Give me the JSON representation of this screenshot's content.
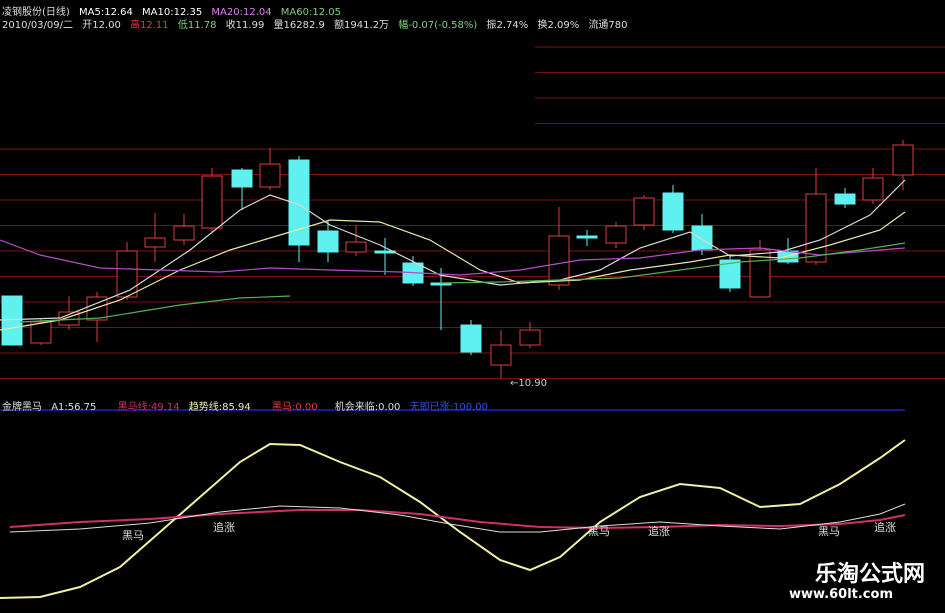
{
  "header": {
    "stock_title": "凌钢股份(日线)",
    "ma5": "MA5:12.64",
    "ma10": "MA10:12.35",
    "ma20": "MA20:12.04",
    "ma60": "MA60:12.05",
    "date": "2010/03/09/二",
    "open": "开12.00",
    "high": "高12.11",
    "low": "低11.78",
    "close": "收11.99",
    "volume": "量16282.9",
    "amount": "额1941.2万",
    "change": "幅-0.07(-0.58%)",
    "amplitude": "振2.74%",
    "turnover": "换2.09%",
    "float": "流通780"
  },
  "price_chart": {
    "low_marker": "←10.90",
    "colors": {
      "up": "#e23b3b",
      "down": "#5ff0f0",
      "ma5": "#d8d8d8",
      "ma10": "#e8e8a8",
      "ma20": "#b050c8",
      "ma60": "#55b055",
      "grid": "#7a1010"
    }
  },
  "indicator": {
    "title": "金牌黑马",
    "a1": "A1:56.75",
    "heima_line": "黑马线:49.14",
    "trend_line": "趋势线:85.94",
    "heima": "黑马:0.00",
    "opportunity": "机会来临:0.00",
    "blank_label": "无即已涨:100.00",
    "label_heima": "黑马",
    "label_zhuizhang": "追涨",
    "colors": {
      "trend": "#f0f0a0",
      "heima": "#d0306a",
      "a1": "#dddddd",
      "blue": "#2020c0"
    }
  },
  "watermark": {
    "brand": "乐淘公式网",
    "url": "www.60lt.com"
  }
}
